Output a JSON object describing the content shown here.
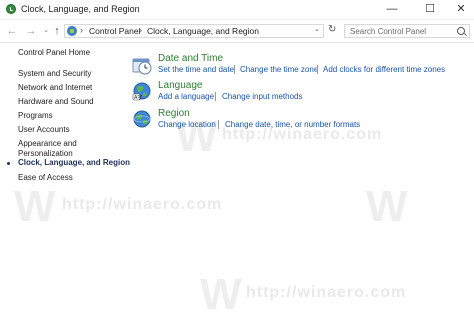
{
  "window": {
    "title": "Clock, Language, and Region",
    "controls": {
      "minimize": "—",
      "maximize": "☐",
      "close": "✕"
    }
  },
  "nav": {
    "back": "←",
    "forward": "→",
    "recent": "⌄",
    "up": "↑"
  },
  "address": {
    "separator": "›",
    "crumbs": [
      "Control Panel",
      "Clock, Language, and Region"
    ],
    "dropdown": "⌄",
    "refresh": "↻"
  },
  "search": {
    "placeholder": "Search Control Panel"
  },
  "sidebar": {
    "home": "Control Panel Home",
    "items": [
      {
        "label": "System and Security"
      },
      {
        "label": "Network and Internet"
      },
      {
        "label": "Hardware and Sound"
      },
      {
        "label": "Programs"
      },
      {
        "label": "User Accounts"
      },
      {
        "label": "Appearance and"
      },
      {
        "label": "Personalization"
      },
      {
        "label": "Clock, Language, and Region",
        "current": true
      },
      {
        "label": "Ease of Access"
      }
    ]
  },
  "categories": [
    {
      "title": "Date and Time",
      "icon": "clock-icon",
      "links": [
        "Set the time and date",
        "Change the time zone",
        "Add clocks for different time zones"
      ]
    },
    {
      "title": "Language",
      "icon": "language-globe-icon",
      "links": [
        "Add a language",
        "Change input methods"
      ]
    },
    {
      "title": "Region",
      "icon": "region-globe-icon",
      "links": [
        "Change location",
        "Change date, time, or number formats"
      ]
    }
  ],
  "watermark": {
    "text": "http://winaero.com",
    "glyph": "W"
  },
  "colors": {
    "category_title": "#2e7d32",
    "link": "#1a54a8",
    "current_nav": "#1f3158"
  }
}
